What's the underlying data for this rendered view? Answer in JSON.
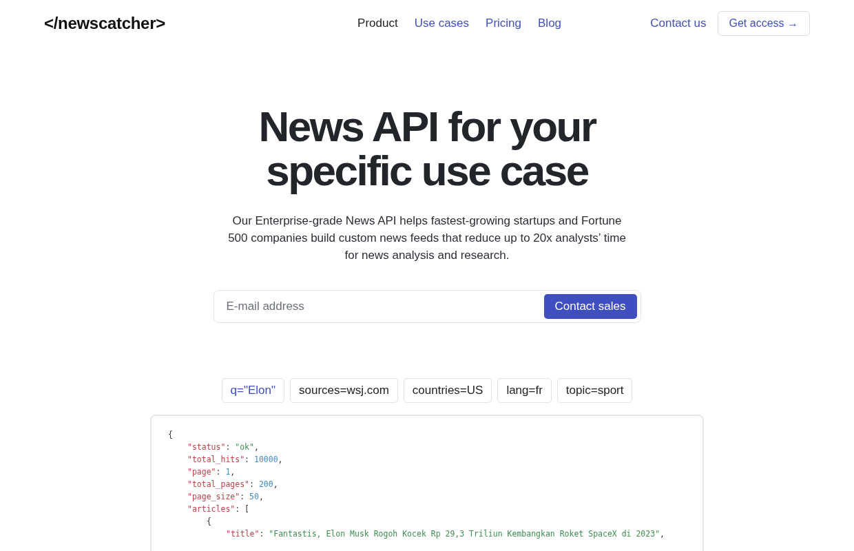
{
  "logo": "</newscatcher>",
  "nav": [
    {
      "label": "Product",
      "selected": true
    },
    {
      "label": "Use cases",
      "selected": false
    },
    {
      "label": "Pricing",
      "selected": false
    },
    {
      "label": "Blog",
      "selected": false
    }
  ],
  "contact_link": "Contact us",
  "access_button": "Get access →",
  "hero": {
    "title": "News API for your specific use case",
    "subtitle": "Our Enterprise-grade News API helps fastest-growing startups and Fortune 500 companies build custom news feeds that reduce up to 20x analysts’ time for news analysis and research."
  },
  "signup": {
    "placeholder": "E-mail address",
    "button": "Contact sales"
  },
  "query_chips": [
    {
      "label": "q=\"Elon\"",
      "selected": true
    },
    {
      "label": "sources=wsj.com",
      "selected": false
    },
    {
      "label": "countries=US",
      "selected": false
    },
    {
      "label": "lang=fr",
      "selected": false
    },
    {
      "label": "topic=sport",
      "selected": false
    }
  ],
  "code_lines": [
    {
      "kind": "root",
      "tokens": [
        {
          "kind": "punct",
          "text": "{"
        }
      ]
    },
    {
      "kind": "field",
      "tokens": [
        {
          "kind": "key",
          "text": "\"status\""
        },
        {
          "kind": "punct",
          "text": ": "
        },
        {
          "kind": "string",
          "text": "\"ok\""
        },
        {
          "kind": "punct",
          "text": ","
        }
      ]
    },
    {
      "kind": "field",
      "tokens": [
        {
          "kind": "key",
          "text": "\"total_hits\""
        },
        {
          "kind": "punct",
          "text": ": "
        },
        {
          "kind": "number",
          "text": "10000"
        },
        {
          "kind": "punct",
          "text": ","
        }
      ]
    },
    {
      "kind": "field",
      "tokens": [
        {
          "kind": "key",
          "text": "\"page\""
        },
        {
          "kind": "punct",
          "text": ": "
        },
        {
          "kind": "number",
          "text": "1"
        },
        {
          "kind": "punct",
          "text": ","
        }
      ]
    },
    {
      "kind": "field",
      "tokens": [
        {
          "kind": "key",
          "text": "\"total_pages\""
        },
        {
          "kind": "punct",
          "text": ": "
        },
        {
          "kind": "number",
          "text": "200"
        },
        {
          "kind": "punct",
          "text": ","
        }
      ]
    },
    {
      "kind": "field",
      "tokens": [
        {
          "kind": "key",
          "text": "\"page_size\""
        },
        {
          "kind": "punct",
          "text": ": "
        },
        {
          "kind": "number",
          "text": "50"
        },
        {
          "kind": "punct",
          "text": ","
        }
      ]
    },
    {
      "kind": "field",
      "tokens": [
        {
          "kind": "key",
          "text": "\"articles\""
        },
        {
          "kind": "punct",
          "text": ": ["
        }
      ]
    },
    {
      "kind": "item",
      "tokens": [
        {
          "kind": "punct",
          "text": "{"
        }
      ]
    },
    {
      "kind": "item_field",
      "tokens": [
        {
          "kind": "key",
          "text": "\"title\""
        },
        {
          "kind": "punct",
          "text": ": "
        },
        {
          "kind": "string",
          "text": "\"Fantastis, Elon Musk Rogoh Kocek Rp 29,3 Triliun Kembangkan Roket SpaceX di 2023\""
        },
        {
          "kind": "punct",
          "text": ","
        }
      ]
    }
  ]
}
